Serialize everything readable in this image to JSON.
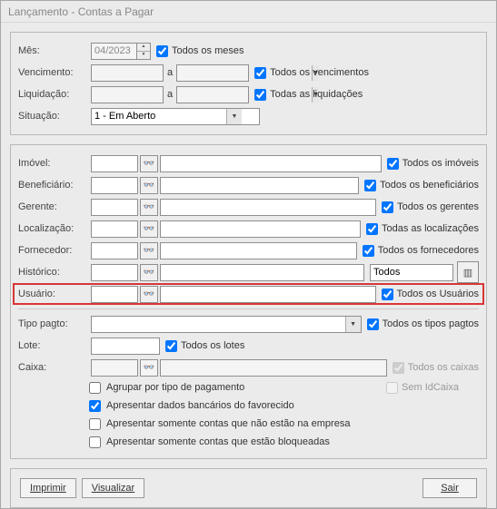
{
  "window": {
    "title": "Lançamento - Contas a Pagar"
  },
  "filters": {
    "mes_label": "Mês:",
    "mes_value": "04/2023",
    "mes_chk": "Todos os meses",
    "venc_label": "Vencimento:",
    "a": "a",
    "venc_chk": "Todos os vencimentos",
    "liq_label": "Liquidação:",
    "liq_chk": "Todas as liquidações",
    "sit_label": "Situação:",
    "sit_value": "1 - Em Aberto"
  },
  "form": {
    "imovel": {
      "label": "Imóvel:",
      "chk": "Todos os imóveis"
    },
    "beneficiario": {
      "label": "Beneficiário:",
      "chk": "Todos os beneficiários"
    },
    "gerente": {
      "label": "Gerente:",
      "chk": "Todos os gerentes"
    },
    "localizacao": {
      "label": "Localização:",
      "chk": "Todas as localizações"
    },
    "fornecedor": {
      "label": "Fornecedor:",
      "chk": "Todos os fornecedores"
    },
    "historico": {
      "label": "Histórico:",
      "combo": "Todos"
    },
    "usuario": {
      "label": "Usuário:",
      "chk": "Todos os Usuários"
    },
    "tipo": {
      "label": "Tipo pagto:",
      "chk": "Todos os tipos pagtos"
    },
    "lote": {
      "label": "Lote:",
      "chk": "Todos os lotes"
    },
    "caixa": {
      "label": "Caixa:",
      "chk": "Todos os caixas",
      "chk2": "Sem IdCaixa"
    }
  },
  "options": {
    "agrupar": "Agrupar por tipo de pagamento",
    "apresentar_bancarios": "Apresentar dados bancários do favorecido",
    "apresentar_nao_empresa": "Apresentar somente contas que não estão na empresa",
    "apresentar_bloqueadas": "Apresentar somente contas que estão bloqueadas"
  },
  "buttons": {
    "imprimir": "Imprimir",
    "visualizar": "Visualizar",
    "sair": "Sair"
  }
}
